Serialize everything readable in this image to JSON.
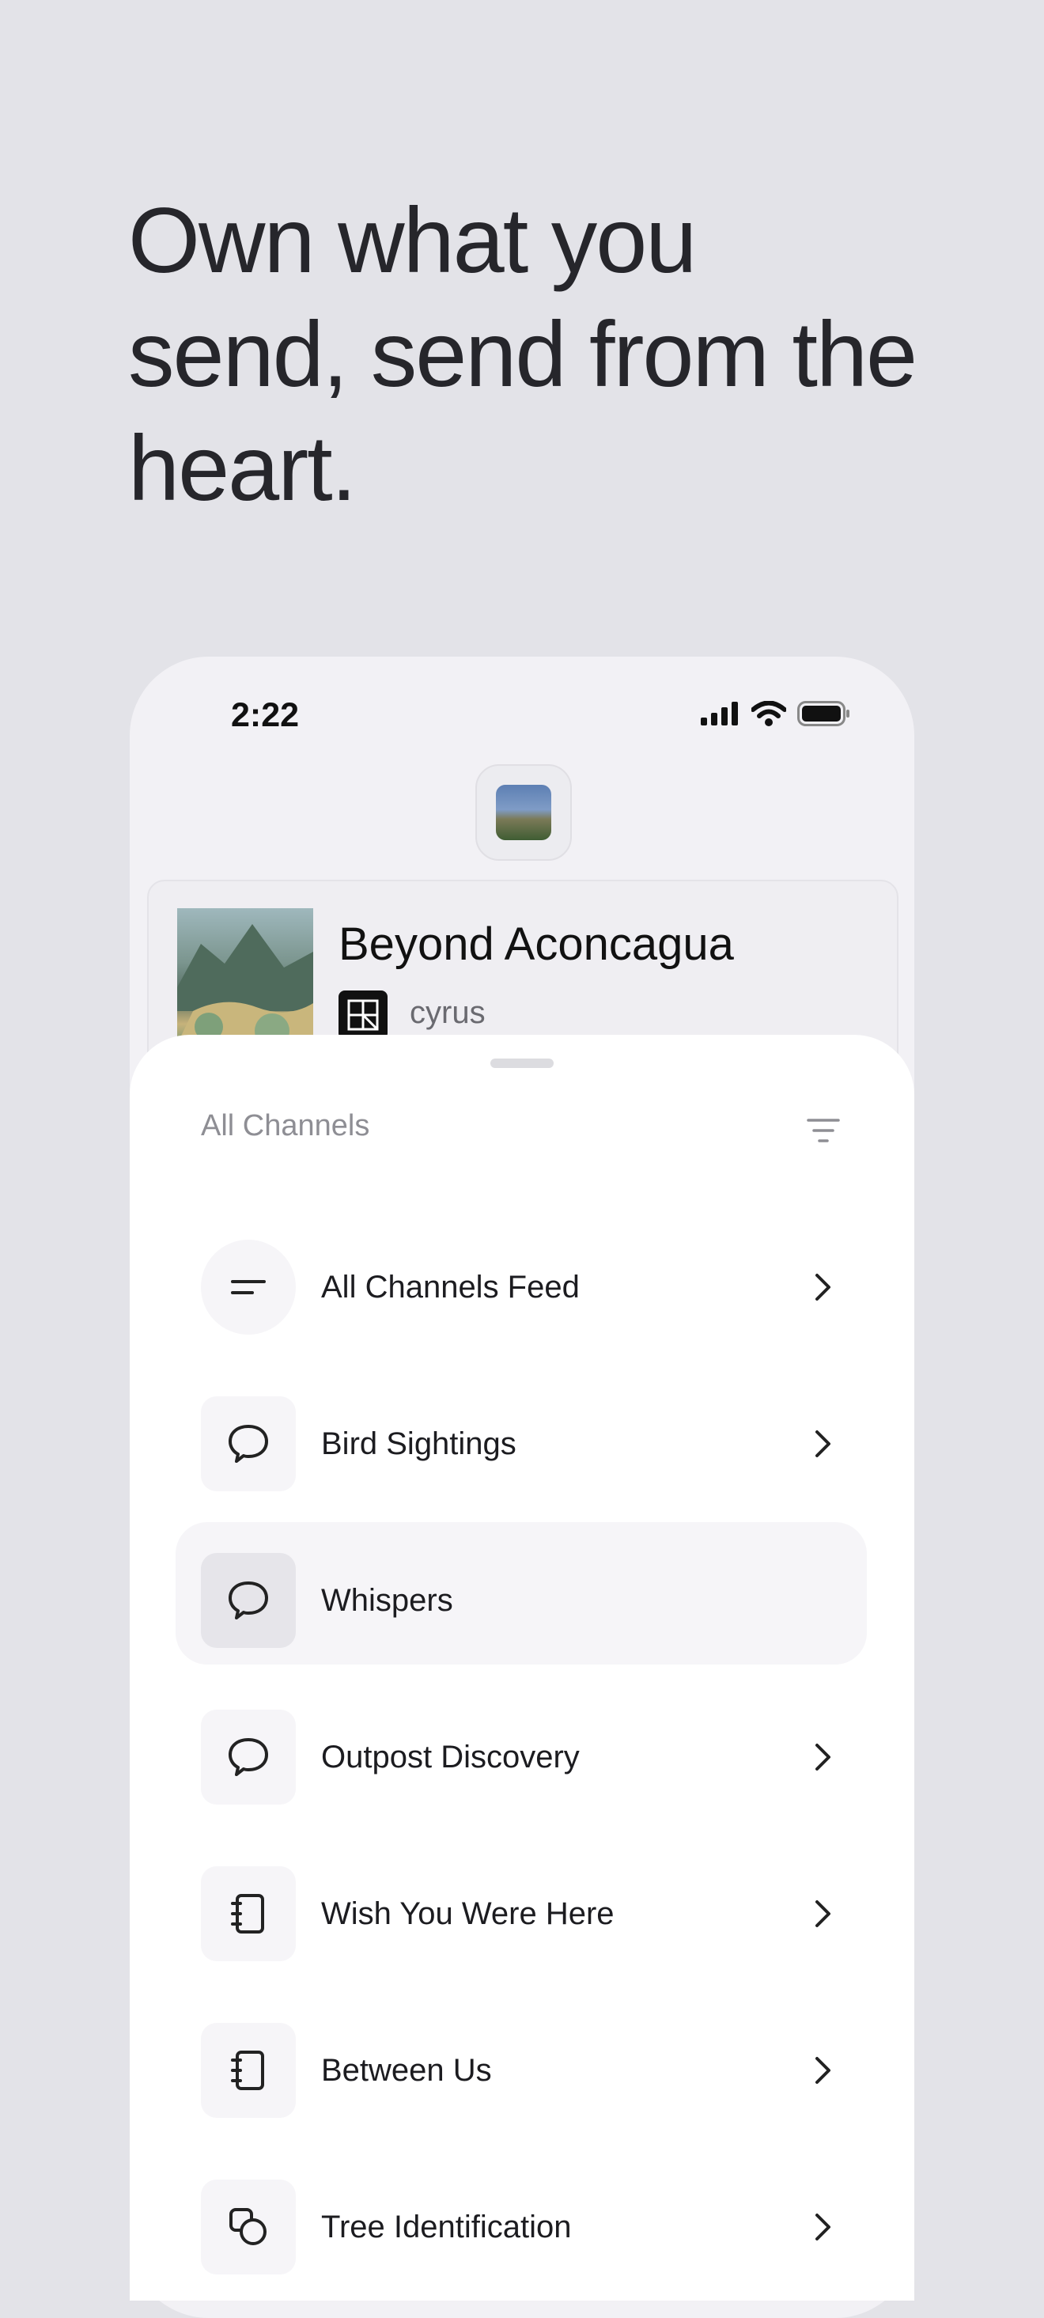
{
  "headline": "Own what you send, send from the heart.",
  "status_bar": {
    "time": "2:22"
  },
  "now_playing": {
    "title": "Beyond Aconcagua",
    "artist": "cyrus"
  },
  "sheet": {
    "title": "All Channels",
    "channels": [
      {
        "label": "All Channels Feed",
        "icon": "feed-lines-icon"
      },
      {
        "label": "Bird Sightings",
        "icon": "chat-bubble-icon"
      },
      {
        "label": "Whispers",
        "icon": "chat-bubble-icon",
        "selected": true
      },
      {
        "label": "Outpost Discovery",
        "icon": "chat-bubble-icon"
      },
      {
        "label": "Wish You Were Here",
        "icon": "notebook-icon"
      },
      {
        "label": "Between Us",
        "icon": "notebook-icon"
      },
      {
        "label": "Tree Identification",
        "icon": "overlapping-shapes-icon"
      }
    ]
  },
  "colors": {
    "background": "#e3e3e8",
    "sheet": "#ffffff",
    "selected_row": "#f6f5f8"
  }
}
